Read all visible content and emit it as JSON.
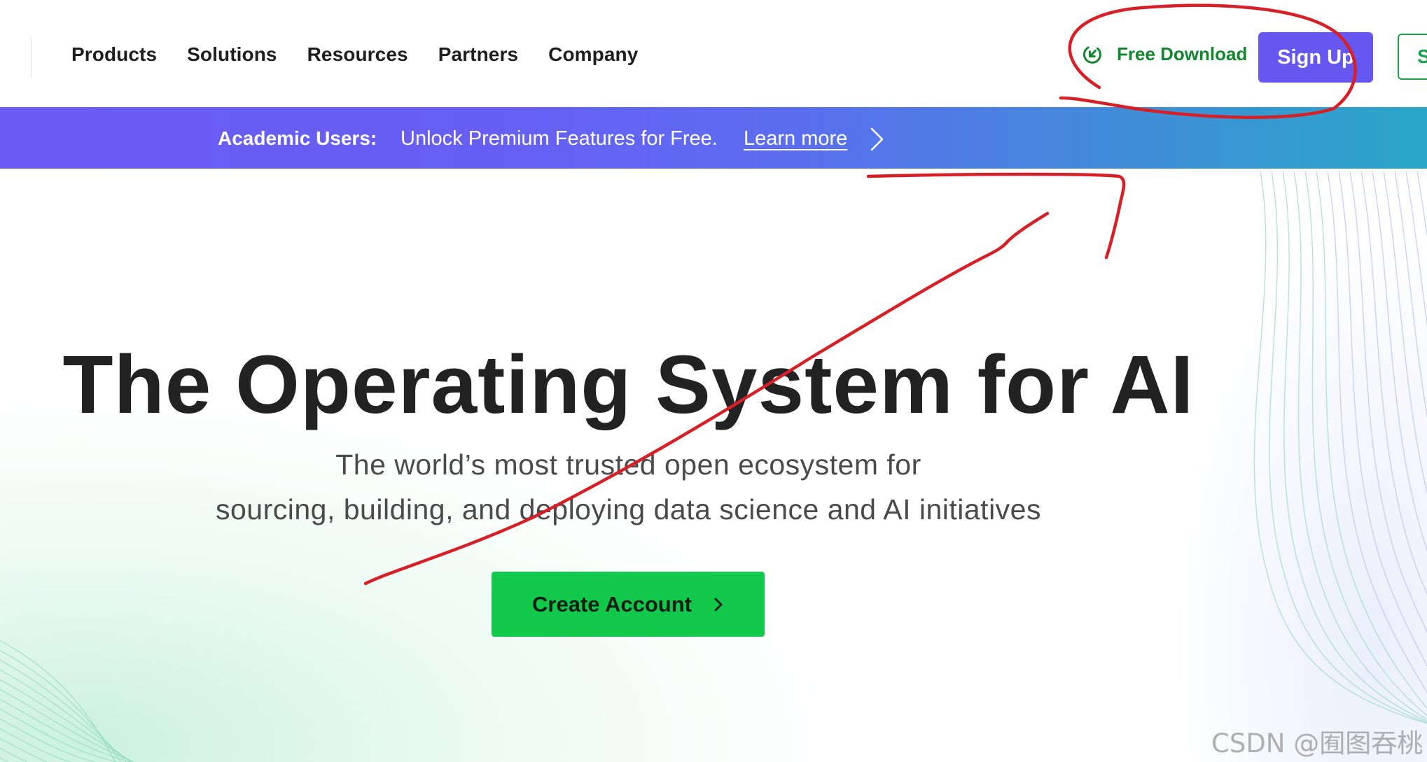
{
  "nav": {
    "items": [
      {
        "label": "Products"
      },
      {
        "label": "Solutions"
      },
      {
        "label": "Resources"
      },
      {
        "label": "Partners"
      },
      {
        "label": "Company"
      }
    ],
    "free_download_label": "Free Download",
    "signup_label": "Sign Up",
    "signin_label_visible": "S"
  },
  "banner": {
    "bold": "Academic Users:",
    "text": "Unlock Premium Features for Free.",
    "link": "Learn more"
  },
  "hero": {
    "title": "The Operating System for AI",
    "subtitle_line1": "The world’s most trusted open ecosystem for",
    "subtitle_line2": "sourcing, building, and deploying data science and AI initiatives",
    "cta_label": "Create Account"
  },
  "watermark": "CSDN @囿图吞桃",
  "colors": {
    "accent_purple": "#6657f0",
    "accent_green": "#12c94c",
    "download_green": "#12852e",
    "annotation_red": "#d61f26"
  },
  "icons": {
    "free_download": "download-circle-icon",
    "banner_arrow": "chevron-right-icon",
    "cta_arrow": "chevron-right-icon"
  }
}
